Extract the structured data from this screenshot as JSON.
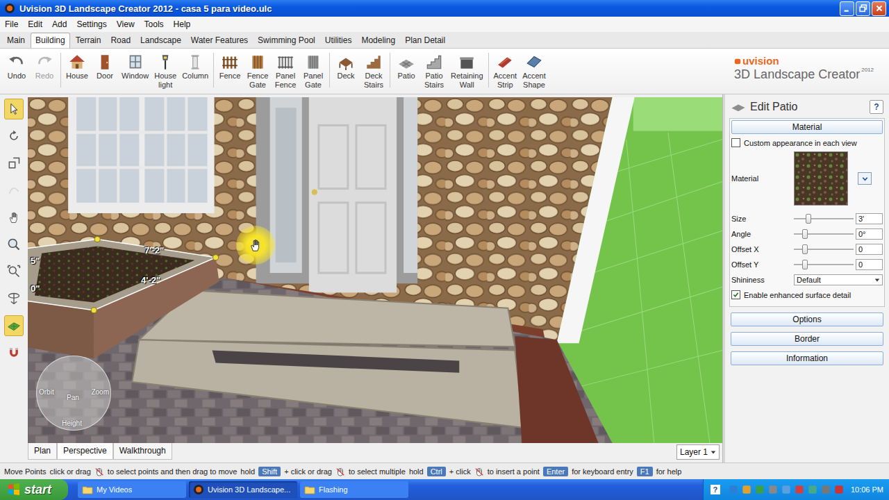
{
  "window": {
    "title": "Uvision 3D Landscape Creator 2012 - casa 5 para video.ulc"
  },
  "menu": [
    "File",
    "Edit",
    "Add",
    "Settings",
    "View",
    "Tools",
    "Help"
  ],
  "tabs": [
    {
      "label": "Main",
      "selected": false
    },
    {
      "label": "Building",
      "selected": true
    },
    {
      "label": "Terrain",
      "selected": false
    },
    {
      "label": "Road",
      "selected": false
    },
    {
      "label": "Landscape",
      "selected": false
    },
    {
      "label": "Water Features",
      "selected": false
    },
    {
      "label": "Swimming Pool",
      "selected": false
    },
    {
      "label": "Utilities",
      "selected": false
    },
    {
      "label": "Modeling",
      "selected": false
    },
    {
      "label": "Plan Detail",
      "selected": false
    }
  ],
  "toolbar": [
    {
      "items": [
        {
          "label": "Undo",
          "disabled": false
        },
        {
          "label": "Redo",
          "disabled": true
        }
      ]
    },
    {
      "items": [
        {
          "label": "House",
          "disabled": false
        },
        {
          "label": "Door",
          "disabled": false
        },
        {
          "label": "Window",
          "disabled": false
        },
        {
          "label": "House light",
          "disabled": false
        },
        {
          "label": "Column",
          "disabled": false
        }
      ]
    },
    {
      "items": [
        {
          "label": "Fence",
          "disabled": false
        },
        {
          "label": "Fence Gate",
          "disabled": false
        },
        {
          "label": "Panel Fence",
          "disabled": false
        },
        {
          "label": "Panel Gate",
          "disabled": false
        }
      ]
    },
    {
      "items": [
        {
          "label": "Deck",
          "disabled": false
        },
        {
          "label": "Deck Stairs",
          "disabled": false
        }
      ]
    },
    {
      "items": [
        {
          "label": "Patio",
          "disabled": false
        },
        {
          "label": "Patio Stairs",
          "disabled": false
        },
        {
          "label": "Retaining Wall",
          "disabled": false
        }
      ]
    },
    {
      "items": [
        {
          "label": "Accent Strip",
          "disabled": false
        },
        {
          "label": "Accent Shape",
          "disabled": false
        }
      ]
    }
  ],
  "logo": {
    "brand": "uvision",
    "product": "3D Landscape Creator",
    "year": "2012"
  },
  "left_tools": [
    {
      "selected": true,
      "disabled": false
    },
    {
      "selected": false,
      "disabled": false
    },
    {
      "selected": false,
      "disabled": false
    },
    {
      "selected": false,
      "disabled": true
    },
    {
      "selected": false,
      "disabled": false
    },
    {
      "selected": false,
      "disabled": false
    },
    {
      "selected": false,
      "disabled": false
    },
    {
      "selected": false,
      "disabled": false
    },
    {
      "selected": true,
      "disabled": false
    },
    {
      "selected": false,
      "disabled": false
    }
  ],
  "viewport": {
    "dimensions": [
      "7'-2\"",
      "4'-2\"",
      "5\"",
      "0\""
    ],
    "navigator": {
      "orbit": "Orbit",
      "pan": "Pan",
      "zoom": "Zoom",
      "height": "Height"
    }
  },
  "view_tabs": [
    {
      "label": "Plan",
      "selected": false
    },
    {
      "label": "Perspective",
      "selected": true
    },
    {
      "label": "Walkthrough",
      "selected": false
    }
  ],
  "layer": "Layer 1",
  "panel": {
    "title": "Edit Patio",
    "help": "?",
    "section": "Material",
    "custom_appearance": {
      "label": "Custom appearance in each view",
      "checked": false
    },
    "material_label": "Material",
    "sliders": [
      {
        "label": "Size",
        "value": "3'",
        "level": 0.24
      },
      {
        "label": "Angle",
        "value": "0°",
        "level": 0.19
      },
      {
        "label": "Offset X",
        "value": "0",
        "level": 0.19
      },
      {
        "label": "Offset Y",
        "value": "0",
        "level": 0.19
      }
    ],
    "shininess": {
      "label": "Shininess",
      "value": "Default"
    },
    "enhanced": {
      "label": "Enable enhanced surface detail",
      "checked": true
    },
    "buttons": [
      "Options",
      "Border",
      "Information"
    ]
  },
  "status_bar": {
    "mode": "Move Points",
    "segments": [
      {
        "kind": "text",
        "text": "click or drag"
      },
      {
        "kind": "mouse",
        "text": ""
      },
      {
        "kind": "text",
        "text": "to select points and then drag to move"
      },
      {
        "kind": "text",
        "text": "hold"
      },
      {
        "kind": "key",
        "text": "Shift"
      },
      {
        "kind": "text",
        "text": "+ click or drag"
      },
      {
        "kind": "mouse",
        "text": ""
      },
      {
        "kind": "text",
        "text": "to select multiple"
      },
      {
        "kind": "text",
        "text": "hold"
      },
      {
        "kind": "key",
        "text": "Ctrl"
      },
      {
        "kind": "text",
        "text": "+ click"
      },
      {
        "kind": "mouse",
        "text": ""
      },
      {
        "kind": "text",
        "text": "to insert a point"
      },
      {
        "kind": "key",
        "text": "Enter"
      },
      {
        "kind": "text",
        "text": "for keyboard entry"
      },
      {
        "kind": "key",
        "text": "F1"
      },
      {
        "kind": "text",
        "text": "for help"
      }
    ]
  },
  "taskbar": {
    "start": "start",
    "tasks": [
      {
        "label": "My Videos",
        "selected": false
      },
      {
        "label": "Uvision 3D Landscape...",
        "selected": true
      },
      {
        "label": "Flashing",
        "selected": false
      }
    ],
    "help": "?",
    "clock": "10:06 PM"
  }
}
